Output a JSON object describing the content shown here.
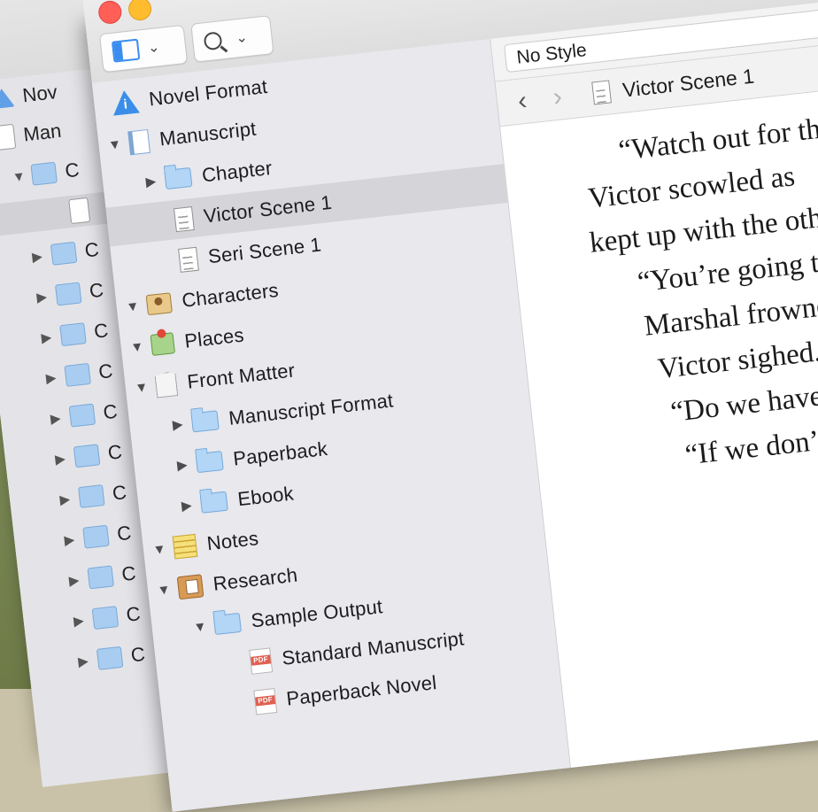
{
  "back_window": {
    "rows": [
      "Nov",
      "Man",
      "C",
      "",
      "C",
      "C",
      "C",
      "C",
      "C",
      "C",
      "C",
      "C",
      "C",
      "C",
      "C"
    ]
  },
  "format_bar": {
    "style": "No Style"
  },
  "nav_bar": {
    "title": "Victor Scene 1"
  },
  "binder": {
    "items": [
      {
        "label": "Novel Format",
        "icon": "info-warning-icon",
        "expand": "none",
        "depth": 0
      },
      {
        "label": "Manuscript",
        "icon": "manuscript-icon",
        "expand": "down",
        "depth": 0
      },
      {
        "label": "Chapter",
        "icon": "folder-icon",
        "expand": "right",
        "depth": 1
      },
      {
        "label": "Victor Scene 1",
        "icon": "document-icon",
        "expand": "none",
        "depth": 1,
        "selected": true
      },
      {
        "label": "Seri Scene 1",
        "icon": "document-icon",
        "expand": "none",
        "depth": 1
      },
      {
        "label": "Characters",
        "icon": "characters-icon",
        "expand": "down",
        "depth": 0
      },
      {
        "label": "Places",
        "icon": "places-icon",
        "expand": "down",
        "depth": 0
      },
      {
        "label": "Front Matter",
        "icon": "front-matter-icon",
        "expand": "down",
        "depth": 0
      },
      {
        "label": "Manuscript Format",
        "icon": "folder-icon",
        "expand": "right",
        "depth": 1
      },
      {
        "label": "Paperback",
        "icon": "folder-icon",
        "expand": "right",
        "depth": 1
      },
      {
        "label": "Ebook",
        "icon": "folder-icon",
        "expand": "right",
        "depth": 1
      },
      {
        "label": "Notes",
        "icon": "notes-icon",
        "expand": "down",
        "depth": 0
      },
      {
        "label": "Research",
        "icon": "research-icon",
        "expand": "down",
        "depth": 0
      },
      {
        "label": "Sample Output",
        "icon": "folder-icon",
        "expand": "down",
        "depth": 1
      },
      {
        "label": "Standard Manuscript",
        "icon": "pdf-icon",
        "expand": "none",
        "depth": 2
      },
      {
        "label": "Paperback Novel",
        "icon": "pdf-icon",
        "expand": "none",
        "depth": 2
      }
    ]
  },
  "editor": {
    "lines": [
      "“Watch out for th",
      "Victor scowled as",
      "kept up with the oth",
      "“You’re going to",
      "Marshal frowne",
      "Victor sighed. “",
      "“Do we have to",
      "“If we don’t, h"
    ]
  },
  "colors": {
    "accent": "#3a8df0",
    "selection": "#d4d4d9",
    "sidebar": "#e8e8ed"
  }
}
